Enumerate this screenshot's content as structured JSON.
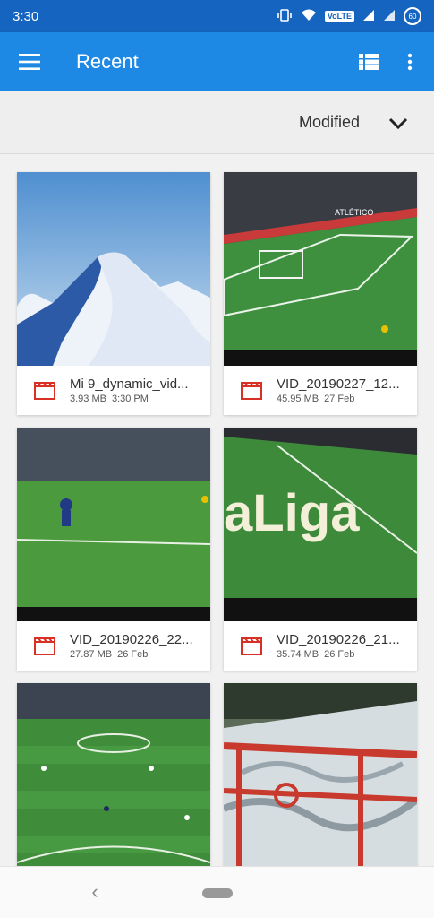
{
  "status_bar": {
    "time": "3:30",
    "volte": "VoLTE",
    "battery": "60",
    "icons": [
      "vibrate-icon",
      "wifi-icon",
      "volte-icon",
      "signal-icon",
      "signal-icon",
      "battery-icon"
    ]
  },
  "app_bar": {
    "title": "Recent",
    "icons": [
      "menu-icon",
      "list-view-icon",
      "more-vert-icon"
    ]
  },
  "sort": {
    "label": "Modified",
    "icon": "chevron-down-icon"
  },
  "files": [
    {
      "name": "Mi 9_dynamic_vid...",
      "size": "3.93 MB",
      "date": "3:30 PM",
      "icon": "video-icon"
    },
    {
      "name": "VID_20190227_12...",
      "size": "45.95 MB",
      "date": "27 Feb",
      "icon": "video-icon"
    },
    {
      "name": "VID_20190226_22...",
      "size": "27.87 MB",
      "date": "26 Feb",
      "icon": "video-icon"
    },
    {
      "name": "VID_20190226_21...",
      "size": "35.74 MB",
      "date": "26 Feb",
      "icon": "video-icon"
    },
    {
      "name": "",
      "size": "",
      "date": "",
      "icon": "video-icon"
    },
    {
      "name": "",
      "size": "",
      "date": "",
      "icon": "video-icon"
    }
  ],
  "thumbnails": {
    "banner_text": "ATLÉTICO",
    "overlay_text": "aLiga"
  },
  "colors": {
    "status_bar": "#1565c0",
    "app_bar": "#1e88e5",
    "video_icon": "#d93025"
  },
  "nav_bar": {
    "icons": [
      "back-icon",
      "home-pill-icon"
    ]
  }
}
